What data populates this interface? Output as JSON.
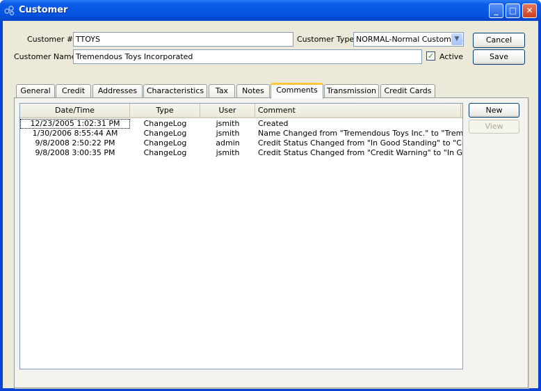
{
  "window": {
    "title": "Customer",
    "icon": "app-icon"
  },
  "form": {
    "customer_number_label": "Customer #:",
    "customer_number": "TTOYS",
    "customer_type_label": "Customer Type:",
    "customer_type": "NORMAL-Normal Customers",
    "customer_name_label": "Customer Name:",
    "customer_name": "Tremendous Toys Incorporated",
    "active_label": "Active",
    "active": true
  },
  "buttons": {
    "cancel": "Cancel",
    "save": "Save",
    "new": "New",
    "view": "View"
  },
  "tabs": [
    "General",
    "Credit",
    "Addresses",
    "Characteristics",
    "Tax",
    "Notes",
    "Comments",
    "Transmission",
    "Credit Cards"
  ],
  "active_tab": "Comments",
  "comments": {
    "columns": [
      "Date/Time",
      "Type",
      "User",
      "Comment"
    ],
    "rows": [
      [
        "12/23/2005 1:02:31 PM",
        "ChangeLog",
        "jsmith",
        "Created"
      ],
      [
        "1/30/2006 8:55:44 AM",
        "ChangeLog",
        "jsmith",
        "Name Changed from \"Tremendous Toys Inc.\" to \"Tremend..."
      ],
      [
        "9/8/2008 2:50:22 PM",
        "ChangeLog",
        "admin",
        "Credit Status Changed from \"In Good Standing\" to \"Credit ..."
      ],
      [
        "9/8/2008 3:00:35 PM",
        "ChangeLog",
        "jsmith",
        "Credit Status Changed from \"Credit Warning\" to \"In Good ..."
      ]
    ]
  }
}
